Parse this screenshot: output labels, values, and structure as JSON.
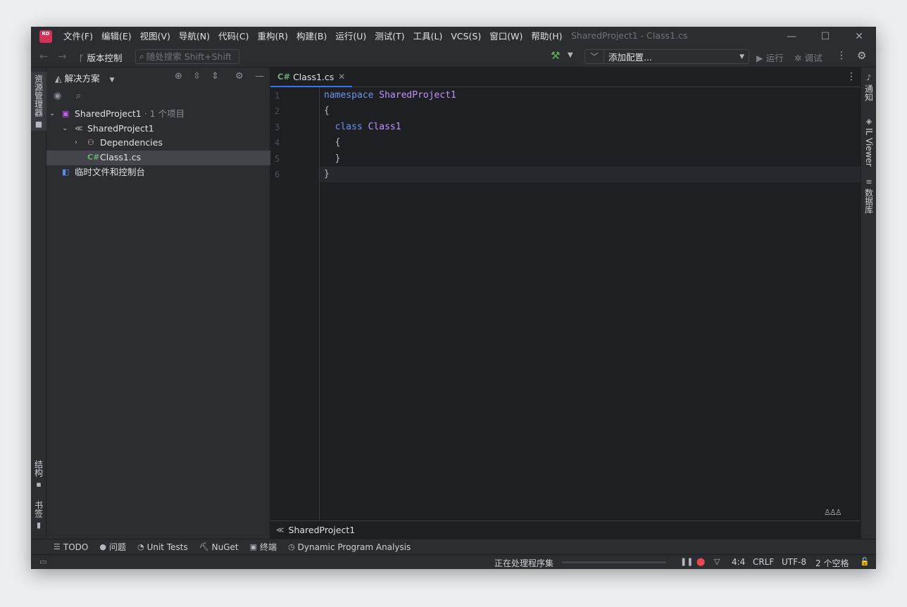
{
  "app": {
    "logo_text": "RD",
    "window_title": "SharedProject1 - Class1.cs"
  },
  "menu": [
    {
      "label": "文件(F)"
    },
    {
      "label": "编辑(E)"
    },
    {
      "label": "视图(V)"
    },
    {
      "label": "导航(N)"
    },
    {
      "label": "代码(C)"
    },
    {
      "label": "重构(R)"
    },
    {
      "label": "构建(B)"
    },
    {
      "label": "运行(U)"
    },
    {
      "label": "测试(T)"
    },
    {
      "label": "工具(L)"
    },
    {
      "label": "VCS(S)"
    },
    {
      "label": "窗口(W)"
    },
    {
      "label": "帮助(H)"
    }
  ],
  "window_controls": {
    "minimize": "—",
    "maximize": "☐",
    "close": "✕"
  },
  "toolbar": {
    "back": "←",
    "forward": "→",
    "vcs_label": "版本控制",
    "search_placeholder": "随处搜索 Shift+Shift",
    "config_label": "添加配置...",
    "run_label": "运行",
    "debug_label": "调试"
  },
  "left_stripe": {
    "explorer": "资源管理器",
    "structure": "结构",
    "bookmarks": "书签"
  },
  "right_stripe": {
    "notifications": "通知",
    "il_viewer": "IL Viewer",
    "database": "数据库"
  },
  "solution": {
    "title": "解决方案",
    "tree": [
      {
        "label": "SharedProject1",
        "suffix": " · 1 个项目"
      },
      {
        "label": "SharedProject1"
      },
      {
        "label": "Dependencies"
      },
      {
        "label": "Class1.cs"
      },
      {
        "label": "临时文件和控制台"
      }
    ]
  },
  "editor": {
    "tab": {
      "prefix": "C#",
      "label": "Class1.cs",
      "close": "✕"
    },
    "line_numbers": [
      "1",
      "2",
      "3",
      "4",
      "5",
      "6"
    ],
    "code": {
      "l1_kw": "namespace",
      "l1_name": "SharedProject1",
      "l2": "{",
      "l3_kw": "class",
      "l3_name": "Class1",
      "l4": "{",
      "l5": "}",
      "l6": "}"
    },
    "breadcrumb": "SharedProject1"
  },
  "tool_windows": [
    {
      "label": "TODO"
    },
    {
      "label": "问题"
    },
    {
      "label": "Unit Tests"
    },
    {
      "label": "NuGet"
    },
    {
      "label": "终端"
    },
    {
      "label": "Dynamic Program Analysis"
    }
  ],
  "status": {
    "progress_text": "正在处理程序集",
    "progress_fraction": 0,
    "caret": "4:4",
    "line_ending": "CRLF",
    "encoding": "UTF-8",
    "indent": "2 个空格"
  },
  "colors": {
    "accent": "#3574f0",
    "keyword": "#6c95eb",
    "type": "#c191ff",
    "error": "#e5484d",
    "csharp_badge": "#6aab73"
  }
}
